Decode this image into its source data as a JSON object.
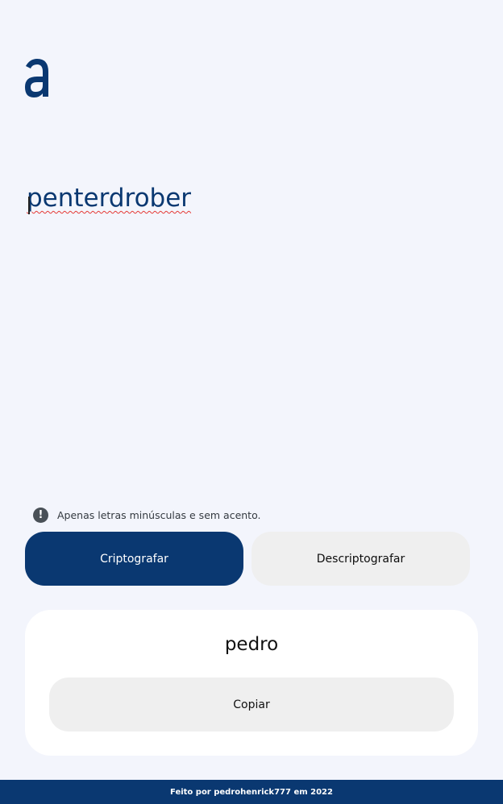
{
  "logo": {
    "icon": "alura-a-logo-icon",
    "color": "#0a3871"
  },
  "input": {
    "value": "penterdrober",
    "spellcheck_error": true
  },
  "hint": {
    "icon": "exclamation-circle-icon",
    "text": "Apenas letras minúsculas e sem acento."
  },
  "buttons": {
    "encrypt_label": "Criptografar",
    "decrypt_label": "Descriptografar"
  },
  "output": {
    "text": "pedro",
    "copy_label": "Copiar"
  },
  "footer": {
    "text": "Feito por pedrohenrick777 em 2022"
  },
  "colors": {
    "primary": "#0a3871",
    "background": "#f3f5fc",
    "secondary_button": "#efefef"
  }
}
